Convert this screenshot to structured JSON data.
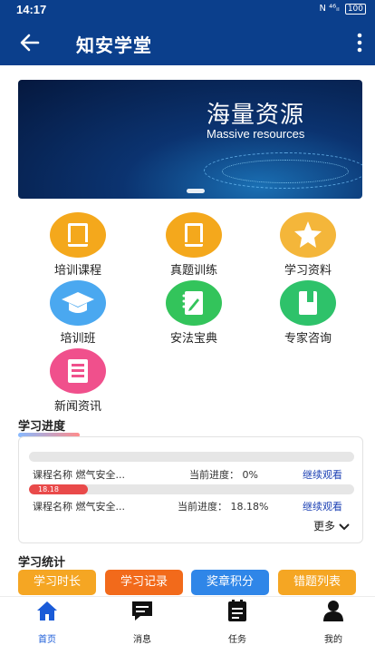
{
  "status_bar": {
    "time": "14:17",
    "signal": "N ⁴⁶ᵢₗ",
    "battery": "100"
  },
  "app_bar": {
    "title": "知安学堂"
  },
  "banner": {
    "title": "海量资源",
    "subtitle": "Massive resources"
  },
  "menu": [
    {
      "label": "培训课程",
      "icon": "book-icon",
      "color": "#f4a81c"
    },
    {
      "label": "真题训练",
      "icon": "notebook-icon",
      "color": "#f4a81c"
    },
    {
      "label": "学习资料",
      "icon": "star-icon",
      "color": "#f4b63a"
    },
    {
      "label": "培训班",
      "icon": "graduation-cap-icon",
      "color": "#4aa8f0"
    },
    {
      "label": "安法宝典",
      "icon": "edit-notebook-icon",
      "color": "#33c45b"
    },
    {
      "label": "专家咨询",
      "icon": "document-icon",
      "color": "#2ec26a"
    },
    {
      "label": "新闻资讯",
      "icon": "news-icon",
      "color": "#f0508c"
    }
  ],
  "progress_section": {
    "title": "学习进度",
    "items": [
      {
        "course": "课程名称  燃气安全...",
        "progress_label": "当前进度：  0%",
        "progress": 0,
        "action": "继续观看"
      },
      {
        "course": "课程名称  燃气安全...",
        "progress_label": "当前进度：  18.18%",
        "progress": 18.18,
        "progress_text": "18.18",
        "action": "继续观看"
      }
    ],
    "more": "更多"
  },
  "stats_section": {
    "title": "学习统计",
    "buttons": [
      {
        "label": "学习时长",
        "color": "#f5a623"
      },
      {
        "label": "学习记录",
        "color": "#f26a1b"
      },
      {
        "label": "奖章积分",
        "color": "#2f86e8"
      },
      {
        "label": "错题列表",
        "color": "#f5a623"
      }
    ]
  },
  "tab_bar": {
    "tabs": [
      {
        "label": "首页",
        "icon": "home-icon",
        "active": true
      },
      {
        "label": "消息",
        "icon": "message-icon",
        "active": false
      },
      {
        "label": "任务",
        "icon": "task-icon",
        "active": false
      },
      {
        "label": "我的",
        "icon": "user-icon",
        "active": false
      }
    ]
  }
}
